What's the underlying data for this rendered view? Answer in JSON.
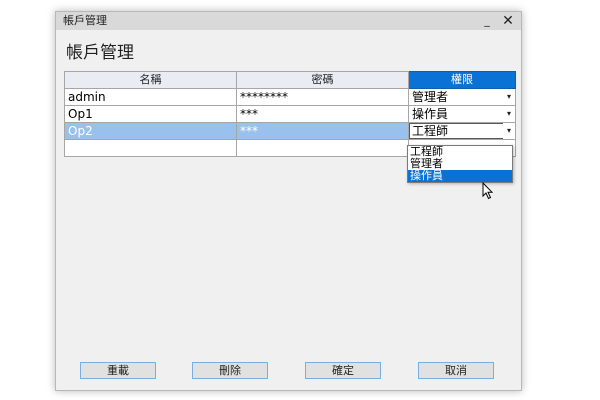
{
  "window": {
    "title": "帳戶管理",
    "minimize_icon": "minimize-icon",
    "close_icon": "close-icon",
    "minimize_glyph": "_",
    "close_glyph": "✕"
  },
  "heading": "帳戶管理",
  "table": {
    "columns": [
      "名稱",
      "密碼",
      "權限"
    ],
    "rows": [
      {
        "name": "admin",
        "password": "********",
        "role": "管理者"
      },
      {
        "name": "Op1",
        "password": "***",
        "role": "操作員"
      },
      {
        "name": "Op2",
        "password": "***",
        "role": "工程師",
        "selected": true
      },
      {
        "name": "",
        "password": "",
        "role": ""
      }
    ],
    "dropdown_arrow": "▾"
  },
  "dropdown": {
    "options": [
      "工程師",
      "管理者",
      "操作員"
    ],
    "highlighted": "操作員"
  },
  "buttons": {
    "reload": "重載",
    "delete": "刪除",
    "confirm": "確定",
    "cancel": "取消"
  },
  "colors": {
    "accent": "#0a72d4",
    "selection": "#99c1ee",
    "button_border": "#7aaee0"
  }
}
